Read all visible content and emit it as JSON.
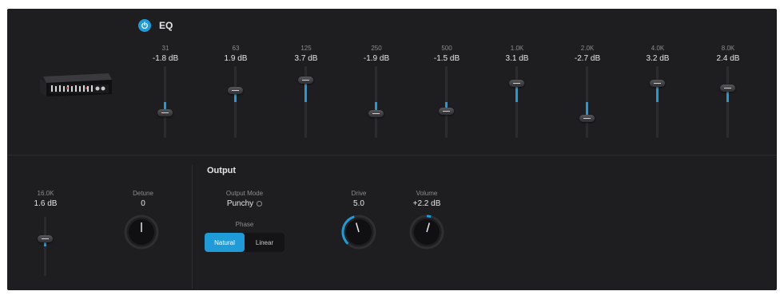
{
  "header": {
    "title": "EQ"
  },
  "eq_bands": [
    {
      "freq": "31",
      "gain": "-1.8 dB",
      "gain_db": -1.8
    },
    {
      "freq": "63",
      "gain": "1.9 dB",
      "gain_db": 1.9
    },
    {
      "freq": "125",
      "gain": "3.7 dB",
      "gain_db": 3.7
    },
    {
      "freq": "250",
      "gain": "-1.9 dB",
      "gain_db": -1.9
    },
    {
      "freq": "500",
      "gain": "-1.5 dB",
      "gain_db": -1.5
    },
    {
      "freq": "1.0K",
      "gain": "3.1 dB",
      "gain_db": 3.1
    },
    {
      "freq": "2.0K",
      "gain": "-2.7 dB",
      "gain_db": -2.7
    },
    {
      "freq": "4.0K",
      "gain": "3.2 dB",
      "gain_db": 3.2
    },
    {
      "freq": "8.0K",
      "gain": "2.4 dB",
      "gain_db": 2.4
    },
    {
      "freq": "16.0K",
      "gain": "1.6 dB",
      "gain_db": 1.6
    }
  ],
  "detune": {
    "label": "Detune",
    "value": "0"
  },
  "output": {
    "title": "Output",
    "mode": {
      "label": "Output Mode",
      "value": "Punchy"
    },
    "phase": {
      "label": "Phase",
      "options": [
        "Natural",
        "Linear"
      ],
      "selected": "Natural"
    },
    "drive": {
      "label": "Drive",
      "value": "5.0"
    },
    "volume": {
      "label": "Volume",
      "value": "+2.2 dB"
    }
  },
  "colors": {
    "accent": "#1f9bd8",
    "panel": "#1e1e20"
  }
}
